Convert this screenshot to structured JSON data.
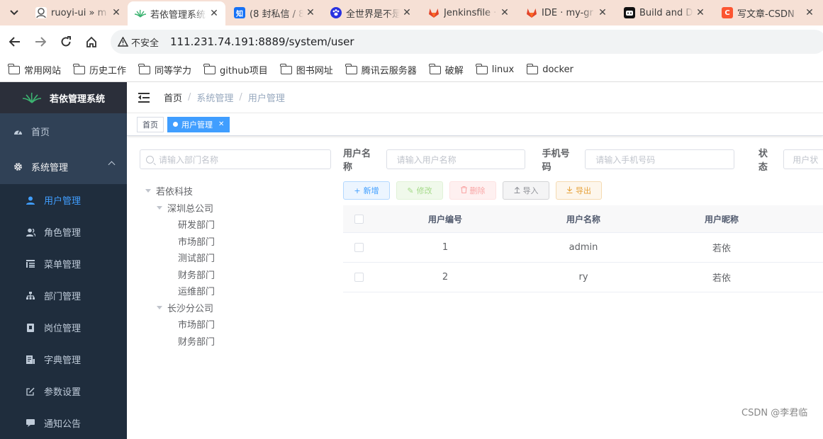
{
  "browser": {
    "tabs": [
      {
        "title": "ruoyi-ui » m",
        "favicon": "ruoyi-icon",
        "active": false
      },
      {
        "title": "若依管理系统",
        "favicon": "ruoyi-leaf-icon",
        "active": true
      },
      {
        "title": "(8 封私信 / 8",
        "favicon": "zhihu-icon",
        "active": false
      },
      {
        "title": "全世界是不是",
        "favicon": "baidu-paw-icon",
        "active": false
      },
      {
        "title": "Jenkinsfile ·",
        "favicon": "gitlab-icon",
        "active": false
      },
      {
        "title": "IDE · my-gr",
        "favicon": "gitlab-icon",
        "active": false
      },
      {
        "title": "Build and D",
        "favicon": "robot-icon",
        "active": false
      },
      {
        "title": "写文章-CSDN",
        "favicon": "csdn-icon",
        "active": false
      }
    ],
    "security_label": "不安全",
    "url": "111.231.74.191:8889/system/user",
    "bookmarks": [
      "常用网站",
      "历史工作",
      "同等学力",
      "github项目",
      "图书网址",
      "腾讯云服务器",
      "破解",
      "linux",
      "docker"
    ]
  },
  "sidebar": {
    "brand": "若依管理系统",
    "items": [
      {
        "label": "首页",
        "icon": "dashboard-icon"
      },
      {
        "label": "系统管理",
        "icon": "gear-icon"
      }
    ],
    "subitems": [
      {
        "label": "用户管理",
        "icon": "user-icon"
      },
      {
        "label": "角色管理",
        "icon": "peoples-icon"
      },
      {
        "label": "菜单管理",
        "icon": "tree-table-icon"
      },
      {
        "label": "部门管理",
        "icon": "tree-icon"
      },
      {
        "label": "岗位管理",
        "icon": "post-icon"
      },
      {
        "label": "字典管理",
        "icon": "dict-icon"
      },
      {
        "label": "参数设置",
        "icon": "edit-icon"
      },
      {
        "label": "通知公告",
        "icon": "message-icon"
      }
    ]
  },
  "header": {
    "breadcrumb": [
      "首页",
      "系统管理",
      "用户管理"
    ]
  },
  "tagsview": {
    "tags": [
      {
        "label": "首页",
        "active": false
      },
      {
        "label": "用户管理",
        "active": true
      }
    ]
  },
  "dept": {
    "search_placeholder": "请输入部门名称",
    "tree": {
      "root": "若依科技",
      "shenzhen": "深圳总公司",
      "sz_children": [
        "研发部门",
        "市场部门",
        "测试部门",
        "财务部门",
        "运维部门"
      ],
      "changsha": "长沙分公司",
      "cs_children": [
        "市场部门",
        "财务部门"
      ]
    }
  },
  "search": {
    "username_label": "用户名称",
    "username_placeholder": "请输入用户名称",
    "phone_label": "手机号码",
    "phone_placeholder": "请输入手机号码",
    "status_label": "状态",
    "status_placeholder": "用户状"
  },
  "actions": {
    "add": "新增",
    "edit": "修改",
    "delete": "删除",
    "import": "导入",
    "export": "导出"
  },
  "table": {
    "headers": [
      "用户编号",
      "用户名称",
      "用户昵称"
    ],
    "rows": [
      [
        "1",
        "admin",
        "若依"
      ],
      [
        "2",
        "ry",
        "若依"
      ]
    ]
  },
  "watermark": "CSDN @李君临",
  "colors": {
    "sidebar_bg": "#304156",
    "submenu_bg": "#1f2d3d",
    "accent": "#409eff"
  }
}
